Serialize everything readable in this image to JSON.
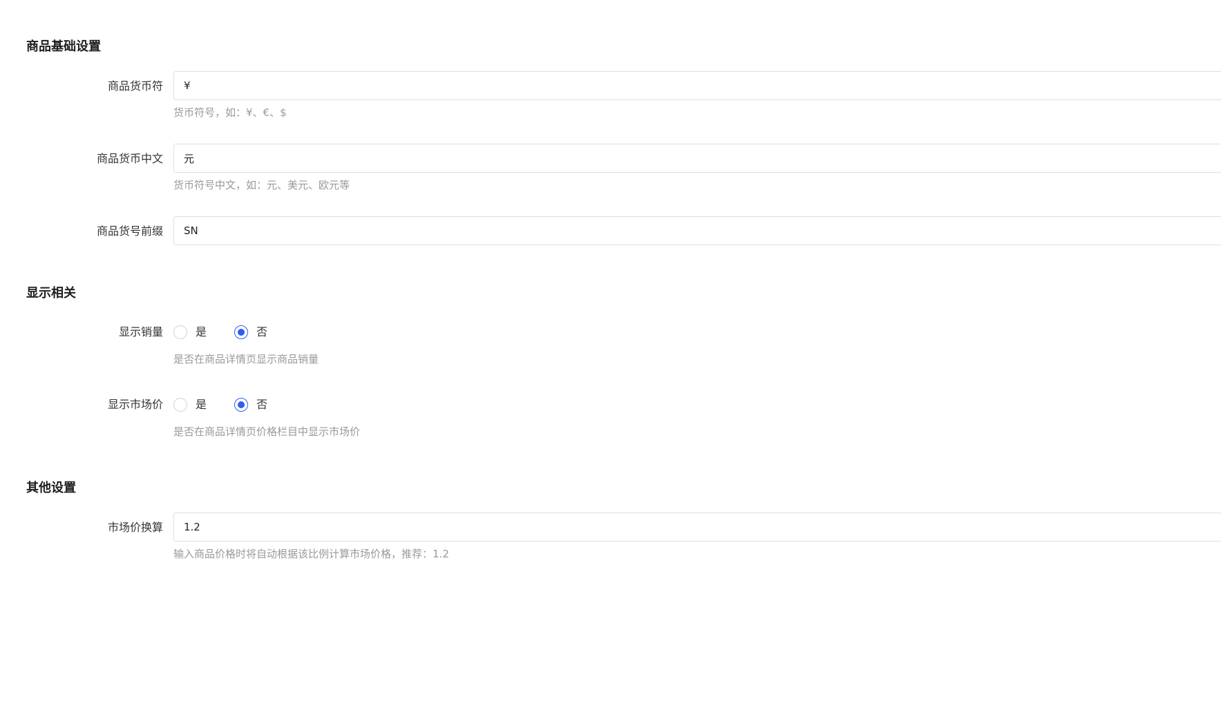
{
  "sections": {
    "basic": {
      "title": "商品基础设置",
      "currency_symbol": {
        "label": "商品货币符",
        "value": "¥",
        "help": "货币符号，如：¥、€、$"
      },
      "currency_name": {
        "label": "商品货币中文",
        "value": "元",
        "help": "货币符号中文，如：元、美元、欧元等"
      },
      "sku_prefix": {
        "label": "商品货号前缀",
        "value": "SN"
      }
    },
    "display": {
      "title": "显示相关",
      "show_sales": {
        "label": "显示销量",
        "options": [
          "是",
          "否"
        ],
        "selected": "否",
        "help": "是否在商品详情页显示商品销量"
      },
      "show_market_price": {
        "label": "显示市场价",
        "options": [
          "是",
          "否"
        ],
        "selected": "否",
        "help": "是否在商品详情页价格栏目中显示市场价"
      }
    },
    "other": {
      "title": "其他设置",
      "market_price_ratio": {
        "label": "市场价换算",
        "value": "1.2",
        "help": "输入商品价格时将自动根据该比例计算市场价格，推荐：1.2"
      }
    }
  },
  "colors": {
    "accent": "#2d5cf6",
    "border": "#dcdfe6",
    "help_text": "#999999"
  }
}
